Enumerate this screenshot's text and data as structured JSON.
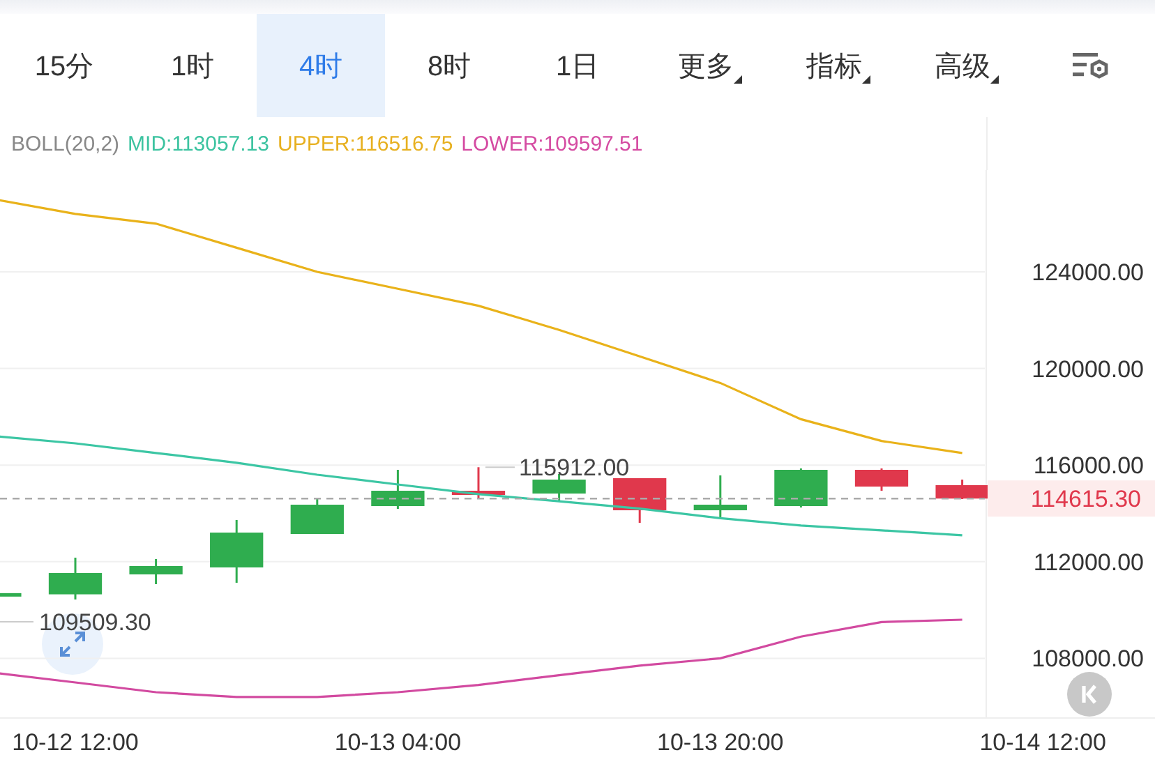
{
  "tabs": [
    {
      "label": "15分",
      "kind": "plain",
      "selected": false
    },
    {
      "label": "1时",
      "kind": "plain",
      "selected": false
    },
    {
      "label": "4时",
      "kind": "plain",
      "selected": true
    },
    {
      "label": "8时",
      "kind": "plain",
      "selected": false
    },
    {
      "label": "1日",
      "kind": "plain",
      "selected": false
    },
    {
      "label": "更多",
      "kind": "menu",
      "selected": false
    },
    {
      "label": "指标",
      "kind": "menu",
      "selected": false
    },
    {
      "label": "高级",
      "kind": "menu",
      "selected": false
    }
  ],
  "legend": {
    "title": "BOLL(20,2)",
    "items": [
      {
        "text": "MID:113057.13",
        "color": "#3cc3a0"
      },
      {
        "text": "UPPER:116516.75",
        "color": "#e7b020"
      },
      {
        "text": "LOWER:109597.51",
        "color": "#d54ba2"
      }
    ]
  },
  "chart_data": {
    "type": "line",
    "categories": [
      null,
      "10-12 12:00",
      null,
      null,
      null,
      "10-13 04:00",
      null,
      null,
      null,
      "10-13 20:00",
      null,
      null,
      null,
      "10-14 12:00"
    ],
    "series": [
      {
        "color": "#e9b21a",
        "values": [
          127000,
          126400,
          126000,
          125000,
          124000,
          123300,
          122600,
          121600,
          120500,
          119400,
          117900,
          117000,
          116500,
          null
        ]
      },
      {
        "color": "#3cc6a4",
        "values": [
          117200,
          116900,
          116500,
          116100,
          115600,
          115200,
          114800,
          114500,
          114200,
          113800,
          113500,
          113300,
          113100,
          null
        ]
      },
      {
        "color": "#d24aa0",
        "values": [
          107400,
          107000,
          106600,
          106400,
          106400,
          106600,
          106900,
          107300,
          107700,
          108000,
          108900,
          109500,
          109600,
          null
        ]
      }
    ],
    "ylim": [
      105530,
      135256
    ],
    "yticks": [
      {
        "value": 108000,
        "label": "108000.00"
      },
      {
        "value": 112000,
        "label": "112000.00"
      },
      {
        "value": 116000,
        "label": "116000.00"
      },
      {
        "value": 120000,
        "label": "120000.00"
      },
      {
        "value": 124000,
        "label": "124000.00"
      }
    ],
    "grid": true,
    "annotations": [
      "115912.00",
      "109509.30"
    ],
    "ref_lines": [
      {
        "axis": "y",
        "value": 114615.3,
        "label": "114615.30",
        "color": "#aaaaaa"
      }
    ]
  }
}
